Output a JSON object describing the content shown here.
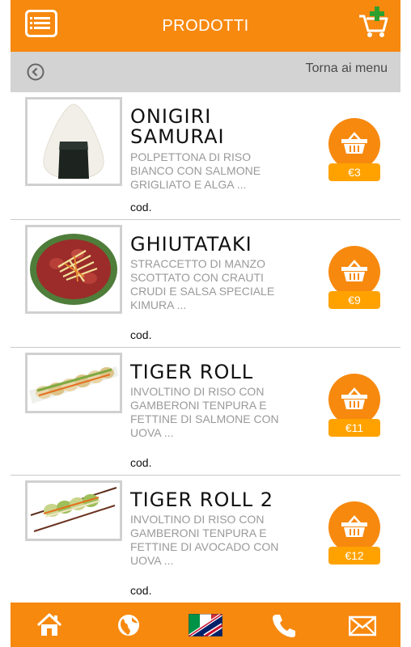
{
  "header": {
    "title": "PRODOTTI",
    "menu_icon": "list-icon",
    "cart_icon": "cart-add-icon"
  },
  "backbar": {
    "label": "Torna ai menu",
    "icon": "back-circle-icon"
  },
  "colors": {
    "accent": "#f7890f",
    "price_badge": "#ffa200",
    "backbar": "#d3d3d3"
  },
  "products": [
    {
      "name_line1": "ONIGIRI",
      "name_line2": "SAMURAI",
      "desc_lines": [
        "POLPETTONA DI RISO",
        "BIANCO CON SALMONE",
        "GRIGLIATO E ALGA ..."
      ],
      "code": "cod.",
      "price": "€3"
    },
    {
      "name_line1": "GHIUTATAKI",
      "name_line2": "",
      "desc_lines": [
        "STRACCETTO DI MANZO",
        "SCOTTATO CON CRAUTI",
        "CRUDI E SALSA SPECIALE",
        "KIMURA ..."
      ],
      "code": "cod.",
      "price": "€9"
    },
    {
      "name_line1": "TIGER ROLL",
      "name_line2": "",
      "desc_lines": [
        "INVOLTINO DI RISO CON",
        "GAMBERONI TENPURA E",
        "FETTINE DI SALMONE CON",
        "UOVA ..."
      ],
      "code": "cod.",
      "price": "€11"
    },
    {
      "name_line1": "TIGER ROLL 2",
      "name_line2": "",
      "desc_lines": [
        "INVOLTINO DI RISO CON",
        "GAMBERONI TENPURA E",
        "FETTINE DI AVOCADO CON",
        "UOVA ..."
      ],
      "code": "cod.",
      "price": "€12"
    }
  ],
  "bottom_nav": [
    "home-icon",
    "globe-icon",
    "language-flag-icon",
    "phone-icon",
    "mail-icon"
  ]
}
